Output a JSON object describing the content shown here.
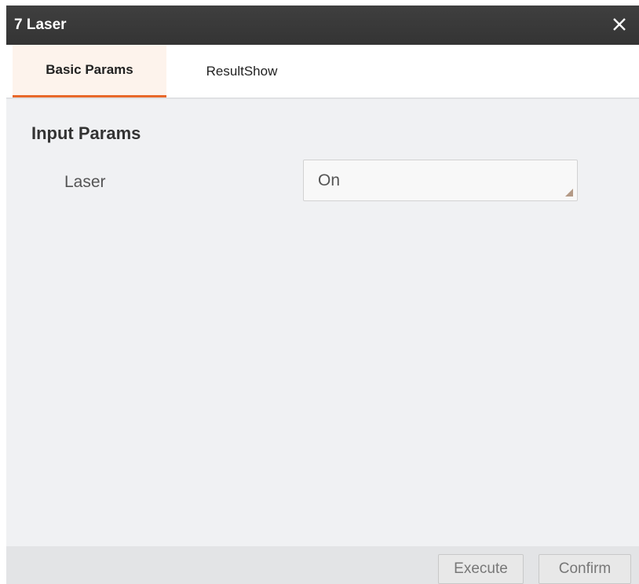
{
  "window": {
    "title": "7 Laser",
    "close_icon": "close-icon"
  },
  "tabs": [
    {
      "label": "Basic Params",
      "active": true
    },
    {
      "label": "ResultShow",
      "active": false
    }
  ],
  "input_params": {
    "section_title": "Input Params",
    "fields": [
      {
        "label": "Laser",
        "value": "On"
      }
    ]
  },
  "footer": {
    "execute_label": "Execute",
    "confirm_label": "Confirm"
  },
  "colors": {
    "titlebar": "#3a3a3a",
    "active_tab_indicator": "#e8682a",
    "panel_background": "#f0f1f3"
  }
}
